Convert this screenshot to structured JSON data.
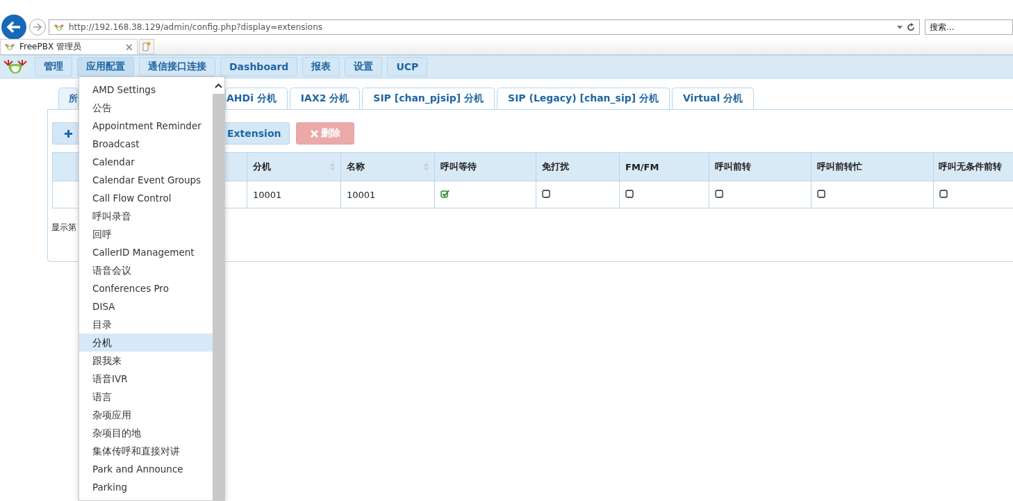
{
  "browser": {
    "url": "http://192.168.38.129/admin/config.php?display=extensions",
    "search_placeholder": "搜索...",
    "tab_title": "FreePBX 管理员",
    "tab_close": "×"
  },
  "nav": [
    {
      "label": "管理",
      "selected": false
    },
    {
      "label": "应用配置",
      "selected": true
    },
    {
      "label": "通信接口连接",
      "selected": false
    },
    {
      "label": "Dashboard",
      "selected": false
    },
    {
      "label": "报表",
      "selected": false
    },
    {
      "label": "设置",
      "selected": false
    },
    {
      "label": "UCP",
      "selected": false
    }
  ],
  "tabs": [
    {
      "label": "所",
      "selected": true
    },
    {
      "label": "AHDi 分机",
      "selected": false
    },
    {
      "label": "IAX2 分机",
      "selected": false
    },
    {
      "label": "SIP [chan_pjsip] 分机",
      "selected": false
    },
    {
      "label": "SIP (Legacy) [chan_sip] 分机",
      "selected": false
    },
    {
      "label": "Virtual 分机",
      "selected": false
    }
  ],
  "actions": {
    "extension_button": "Extension",
    "delete_button": "删除",
    "delete_disabled": true
  },
  "table": {
    "columns": [
      {
        "label": "分机",
        "sortable": true
      },
      {
        "label": "名称",
        "sortable": true
      },
      {
        "label": "呼叫等待",
        "sortable": false
      },
      {
        "label": "免打扰",
        "sortable": false
      },
      {
        "label": "FM/FM",
        "sortable": false
      },
      {
        "label": "呼叫前转",
        "sortable": false
      },
      {
        "label": "呼叫前转忙",
        "sortable": false
      },
      {
        "label": "呼叫无条件前转",
        "sortable": false
      }
    ],
    "rows": [
      {
        "extension": "10001",
        "name": "10001",
        "flags": [
          true,
          false,
          false,
          false,
          false,
          false
        ]
      }
    ]
  },
  "footer_text": "显示第",
  "menu": {
    "items": [
      {
        "label": "AMD Settings",
        "selected": false
      },
      {
        "label": "公告",
        "selected": false
      },
      {
        "label": "Appointment Reminder",
        "selected": false
      },
      {
        "label": "Broadcast",
        "selected": false
      },
      {
        "label": "Calendar",
        "selected": false
      },
      {
        "label": "Calendar Event Groups",
        "selected": false
      },
      {
        "label": "Call Flow Control",
        "selected": false
      },
      {
        "label": "呼叫录音",
        "selected": false
      },
      {
        "label": "回呼",
        "selected": false
      },
      {
        "label": "CallerID Management",
        "selected": false
      },
      {
        "label": "语音会议",
        "selected": false
      },
      {
        "label": "Conferences Pro",
        "selected": false
      },
      {
        "label": "DISA",
        "selected": false
      },
      {
        "label": "目录",
        "selected": false
      },
      {
        "label": "分机",
        "selected": true
      },
      {
        "label": "跟我来",
        "selected": false
      },
      {
        "label": "语音IVR",
        "selected": false
      },
      {
        "label": "语言",
        "selected": false
      },
      {
        "label": "杂项应用",
        "selected": false
      },
      {
        "label": "杂项目的地",
        "selected": false
      },
      {
        "label": "集体传呼和直接对讲",
        "selected": false
      },
      {
        "label": "Park and Announce",
        "selected": false
      },
      {
        "label": "Parking",
        "selected": false
      }
    ]
  }
}
